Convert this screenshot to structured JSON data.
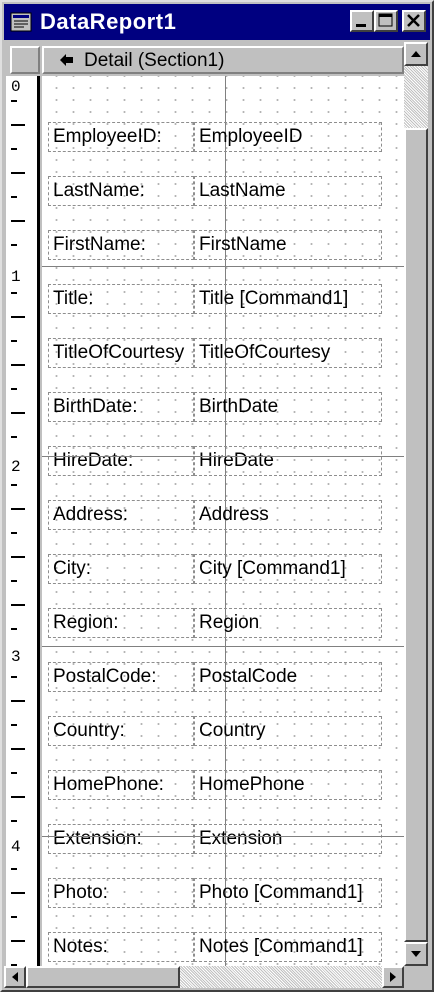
{
  "window": {
    "title": "DataReport1"
  },
  "section": {
    "label": "Detail (Section1)"
  },
  "ruler": {
    "marks": [
      "0",
      "1",
      "2",
      "3",
      "4"
    ]
  },
  "fields": [
    {
      "label": "EmployeeID:",
      "value": "EmployeeID"
    },
    {
      "label": "LastName:",
      "value": "LastName"
    },
    {
      "label": "FirstName:",
      "value": "FirstName"
    },
    {
      "label": "Title:",
      "value": "Title [Command1]"
    },
    {
      "label": "TitleOfCourtesy",
      "value": "TitleOfCourtesy"
    },
    {
      "label": "BirthDate:",
      "value": "BirthDate"
    },
    {
      "label": "HireDate:",
      "value": "HireDate"
    },
    {
      "label": "Address:",
      "value": "Address"
    },
    {
      "label": "City:",
      "value": "City [Command1]"
    },
    {
      "label": "Region:",
      "value": "Region"
    },
    {
      "label": "PostalCode:",
      "value": "PostalCode"
    },
    {
      "label": "Country:",
      "value": "Country"
    },
    {
      "label": "HomePhone:",
      "value": "HomePhone"
    },
    {
      "label": "Extension:",
      "value": "Extension"
    },
    {
      "label": "Photo:",
      "value": "Photo [Command1]"
    },
    {
      "label": "Notes:",
      "value": "Notes [Command1]"
    }
  ],
  "icons": {
    "app": "report-icon",
    "minimize": "minimize-icon",
    "maximize": "maximize-icon",
    "close": "close-icon",
    "section": "pointing-hand-icon",
    "scroll_up": "arrow-up-icon",
    "scroll_down": "arrow-down-icon",
    "scroll_left": "arrow-left-icon",
    "scroll_right": "arrow-right-icon"
  },
  "colors": {
    "titlebar": "#000080",
    "face": "#c0c0c0",
    "canvas": "#ffffff"
  }
}
